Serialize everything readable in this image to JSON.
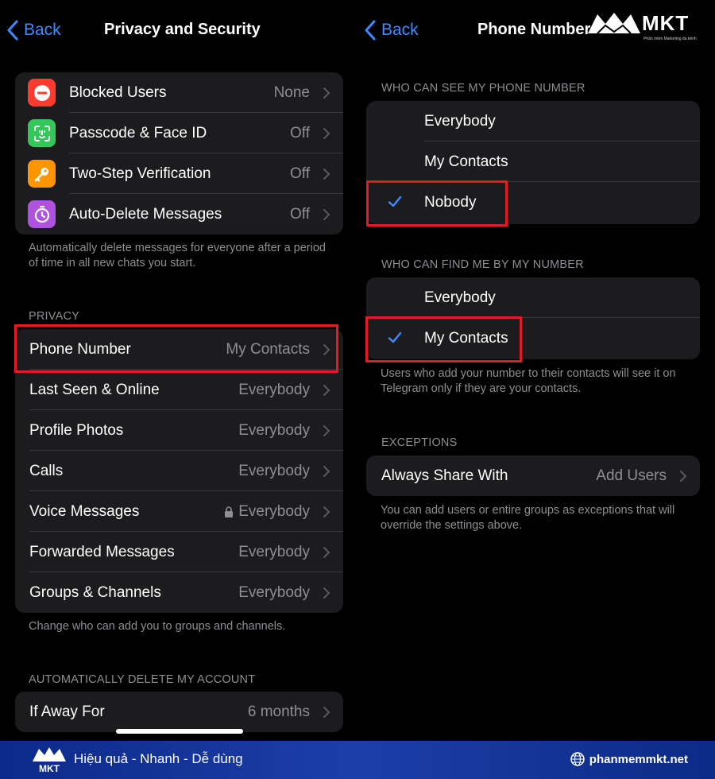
{
  "left": {
    "nav": {
      "back": "Back",
      "title": "Privacy and Security"
    },
    "security_rows": [
      {
        "label": "Blocked Users",
        "value": "None",
        "icon": "blocked-icon",
        "color": "#ff3b30"
      },
      {
        "label": "Passcode & Face ID",
        "value": "Off",
        "icon": "face-id-icon",
        "color": "#34c759"
      },
      {
        "label": "Two-Step Verification",
        "value": "Off",
        "icon": "key-icon",
        "color": "#ff9500"
      },
      {
        "label": "Auto-Delete Messages",
        "value": "Off",
        "icon": "timer-icon",
        "color": "#af52de"
      }
    ],
    "security_caption": "Automatically delete messages for everyone after a period of time in all new chats you start.",
    "privacy_header": "PRIVACY",
    "privacy_rows": [
      {
        "label": "Phone Number",
        "value": "My Contacts"
      },
      {
        "label": "Last Seen & Online",
        "value": "Everybody"
      },
      {
        "label": "Profile Photos",
        "value": "Everybody"
      },
      {
        "label": "Calls",
        "value": "Everybody"
      },
      {
        "label": "Voice Messages",
        "value": "Everybody",
        "locked": true
      },
      {
        "label": "Forwarded Messages",
        "value": "Everybody"
      },
      {
        "label": "Groups & Channels",
        "value": "Everybody"
      }
    ],
    "privacy_caption": "Change who can add you to groups and channels.",
    "delete_header": "AUTOMATICALLY DELETE MY ACCOUNT",
    "delete_row": {
      "label": "If Away For",
      "value": "6 months"
    }
  },
  "right": {
    "nav": {
      "back": "Back",
      "title": "Phone Number"
    },
    "see_header": "WHO CAN SEE MY PHONE NUMBER",
    "see_options": [
      {
        "label": "Everybody",
        "checked": false
      },
      {
        "label": "My Contacts",
        "checked": false
      },
      {
        "label": "Nobody",
        "checked": true
      }
    ],
    "find_header": "WHO CAN FIND ME BY MY NUMBER",
    "find_options": [
      {
        "label": "Everybody",
        "checked": false
      },
      {
        "label": "My Contacts",
        "checked": true
      }
    ],
    "find_caption": "Users who add your number to their contacts will see it on Telegram only if they are your contacts.",
    "exceptions_header": "EXCEPTIONS",
    "exceptions_row": {
      "label": "Always Share With",
      "value": "Add Users"
    },
    "exceptions_caption": "You can add users or entire groups as exceptions that will override the settings above."
  },
  "brand": {
    "logo_text": "MKT",
    "logo_sub": "Phần mềm Marketing đa kênh",
    "slogan": "Hiệu quả - Nhanh - Dễ dùng",
    "url": "phanmemmkt.net"
  },
  "colors": {
    "accent": "#3d8cff",
    "highlight": "#e31b23",
    "cell": "#1c1c1e",
    "secondary_text": "#8e8e93"
  }
}
